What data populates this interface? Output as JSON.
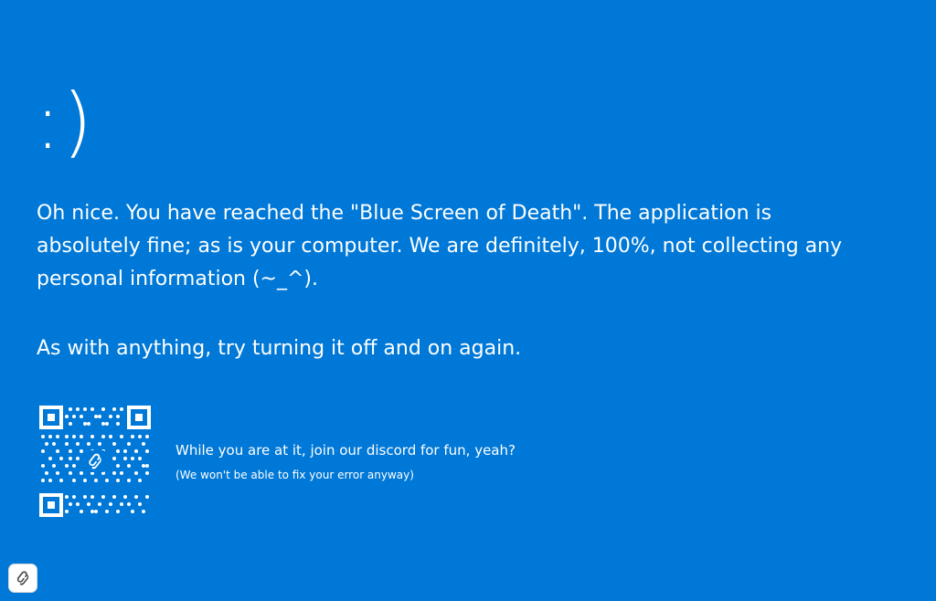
{
  "screen": {
    "background_color": "#0078d7",
    "text_color": "#ffffff",
    "face": ":)",
    "message_primary": "Oh nice. You have reached the \"Blue Screen of Death\". The application is absolutely fine; as is your computer. We are definitely, 100%, not collecting any personal information (~_^).",
    "message_secondary": "As with anything, try turning it off and on again."
  },
  "discord": {
    "qr_icon": "qr-code-icon",
    "center_logo_icon": "svelte-logo-icon",
    "title": "While you are at it, join our discord for fun, yeah?",
    "subtitle": "(We won't be able to fix your error anyway)"
  },
  "corner": {
    "icon": "svelte-logo-icon"
  }
}
